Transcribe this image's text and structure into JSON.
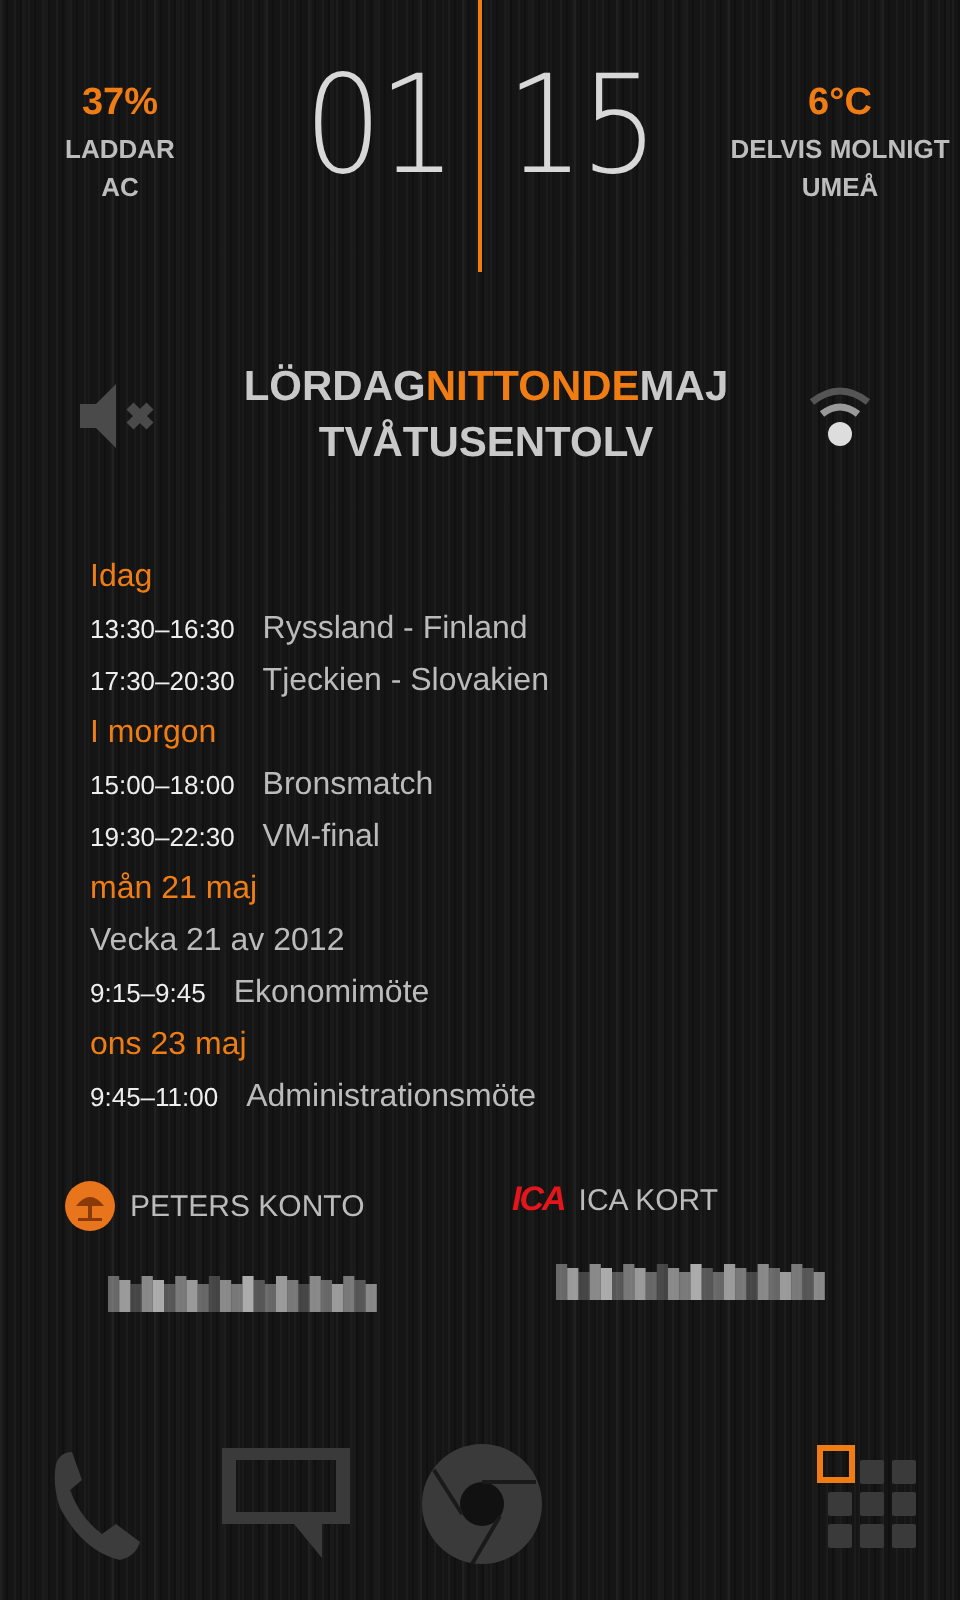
{
  "battery": {
    "percent": "37%",
    "state": "LADDAR",
    "source": "AC"
  },
  "clock": {
    "hours": "01",
    "minutes": "15"
  },
  "weather": {
    "temperature": "6°C",
    "condition": "DELVIS MOLNIGT",
    "location": "UMEÅ"
  },
  "sound": {
    "muted": true
  },
  "date": {
    "parts": [
      {
        "text": "LÖRDAG",
        "highlight": false
      },
      {
        "text": "NITTONDE",
        "highlight": true
      },
      {
        "text": "MAJ",
        "highlight": false
      }
    ],
    "year": "TVÅTUSENTOLV"
  },
  "agenda": [
    {
      "kind": "header",
      "text": "Idag"
    },
    {
      "kind": "event",
      "time": "13:30–16:30",
      "title": "Ryssland - Finland"
    },
    {
      "kind": "event",
      "time": "17:30–20:30",
      "title": "Tjeckien - Slovakien"
    },
    {
      "kind": "header",
      "text": "I morgon"
    },
    {
      "kind": "event",
      "time": "15:00–18:00",
      "title": "Bronsmatch"
    },
    {
      "kind": "event",
      "time": "19:30–22:30",
      "title": "VM-final"
    },
    {
      "kind": "header",
      "text": "mån 21 maj"
    },
    {
      "kind": "note",
      "text": "Vecka 21 av 2012"
    },
    {
      "kind": "event",
      "time": "9:15–9:45",
      "title": "Ekonomimöte"
    },
    {
      "kind": "header",
      "text": "ons 23 maj"
    },
    {
      "kind": "event",
      "time": "9:45–11:00",
      "title": "Administrationsmöte"
    }
  ],
  "accounts": [
    {
      "kind": "bank",
      "name": "PETERS KONTO"
    },
    {
      "kind": "store",
      "name": "ICA KORT",
      "logo": "ICA"
    }
  ],
  "dock": [
    {
      "kind": "phone"
    },
    {
      "kind": "messages"
    },
    {
      "kind": "browser"
    },
    {
      "kind": "apps"
    }
  ]
}
